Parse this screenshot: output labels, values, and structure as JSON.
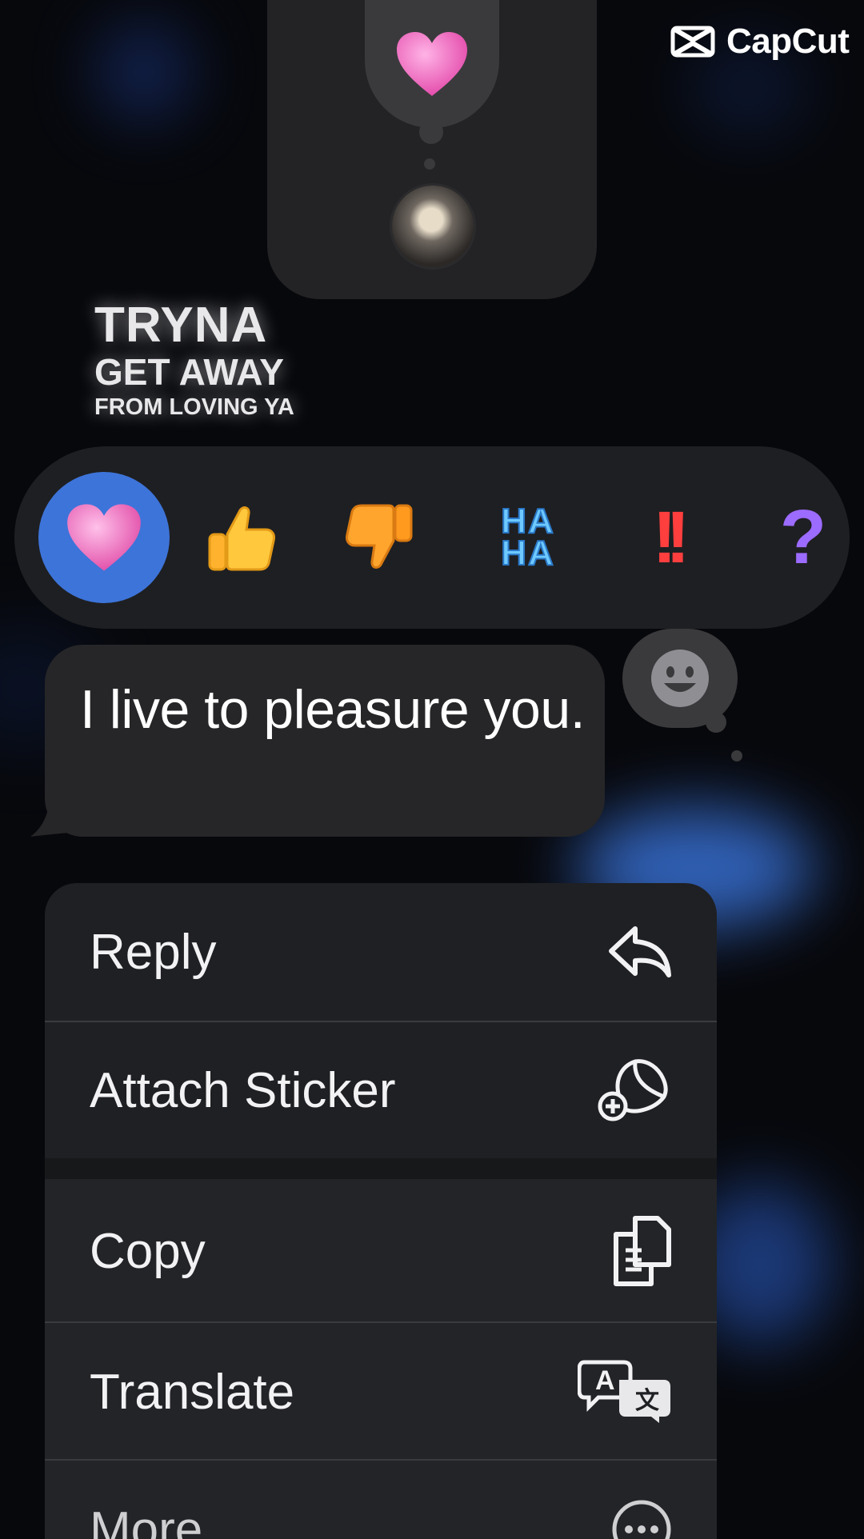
{
  "watermark": {
    "brand": "CapCut"
  },
  "reaction_preview": {
    "reaction": "heart-icon",
    "reactor_avatar": "user-avatar"
  },
  "lyrics": {
    "line1": "TRYNA",
    "line2": "GET AWAY",
    "line3": "FROM LOVING YA"
  },
  "tapbacks": [
    {
      "name": "heart",
      "selected": true
    },
    {
      "name": "thumbs-up",
      "selected": false
    },
    {
      "name": "thumbs-down",
      "selected": false
    },
    {
      "name": "haha",
      "label": "HA\nHA",
      "selected": false
    },
    {
      "name": "exclamation",
      "label": "!!",
      "selected": false
    },
    {
      "name": "question",
      "label": "?",
      "selected": false
    }
  ],
  "message": {
    "text": "I live to pleasure you."
  },
  "menu": {
    "items": [
      {
        "label": "Reply",
        "icon": "reply-icon"
      },
      {
        "label": "Attach Sticker",
        "icon": "sticker-add-icon"
      },
      {
        "label": "Copy",
        "icon": "copy-icon"
      },
      {
        "label": "Translate",
        "icon": "translate-icon"
      },
      {
        "label": "More...",
        "icon": "more-icon"
      }
    ]
  },
  "colors": {
    "selected_tapback": "#3d74d9",
    "bubble": "#262628",
    "menu": "#1f2023"
  }
}
